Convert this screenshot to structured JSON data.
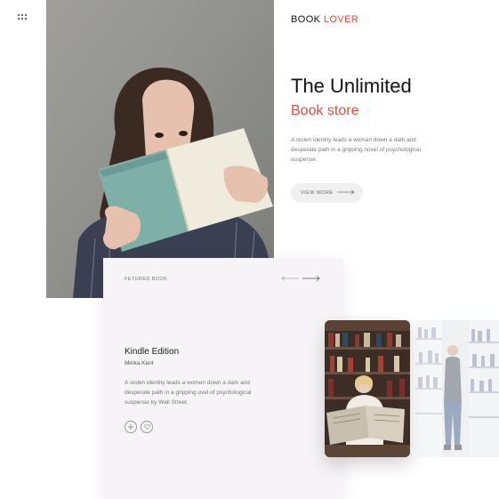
{
  "nav": {
    "menu_icon": "grid-dots-icon"
  },
  "brand": {
    "name_part1": "BOOK",
    "name_part2": "LOVER",
    "accent_color": "#e8493b"
  },
  "hero": {
    "title": "The Unlimited",
    "subtitle": "Book store",
    "description": "A stolen identity leads a woman down a dark and desperate path in a gripping novel of psychological suspense.",
    "cta_label": "VIEW MORE",
    "cta_icon": "arrow-right-icon",
    "photo": "woman-holding-open-book"
  },
  "featured": {
    "eyebrow": "FETURED BOOK",
    "prev_icon": "arrow-left-icon",
    "next_icon": "arrow-right-icon",
    "book_title": "Kindle Edition",
    "author": "Minka Kent",
    "description": "A stolen identity leads a women down a dark and desperate path in a gripping ovel of psychological suspense by Wall Street.",
    "add_icon": "plus-icon",
    "like_icon": "heart-icon"
  },
  "gallery": [
    {
      "name": "woman-reading-newspaper-in-library"
    },
    {
      "name": "person-browsing-bookshelves"
    }
  ]
}
